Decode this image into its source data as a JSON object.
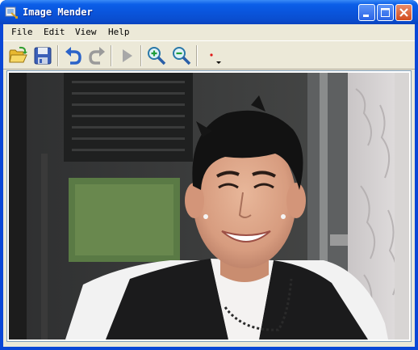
{
  "window": {
    "title": "Image Mender",
    "controls": {
      "minimize": "minimize",
      "maximize": "maximize",
      "close": "close"
    }
  },
  "menu": {
    "items": [
      {
        "label": "File"
      },
      {
        "label": "Edit"
      },
      {
        "label": "View"
      },
      {
        "label": "Help"
      }
    ]
  },
  "toolbar": {
    "tools": [
      {
        "icon": "open-folder-icon"
      },
      {
        "icon": "save-icon"
      },
      {
        "icon": "undo-icon"
      },
      {
        "icon": "redo-icon"
      },
      {
        "icon": "play-icon"
      },
      {
        "icon": "zoom-in-icon"
      },
      {
        "icon": "zoom-out-icon"
      },
      {
        "icon": "brush-dropdown-icon"
      }
    ]
  },
  "canvas": {
    "image_subject": "photo of a smiling young man with dark hair in front of a building"
  },
  "colors": {
    "titlebar": "#0a55dc",
    "face": "#ece9d8",
    "close": "#d24c1f"
  }
}
